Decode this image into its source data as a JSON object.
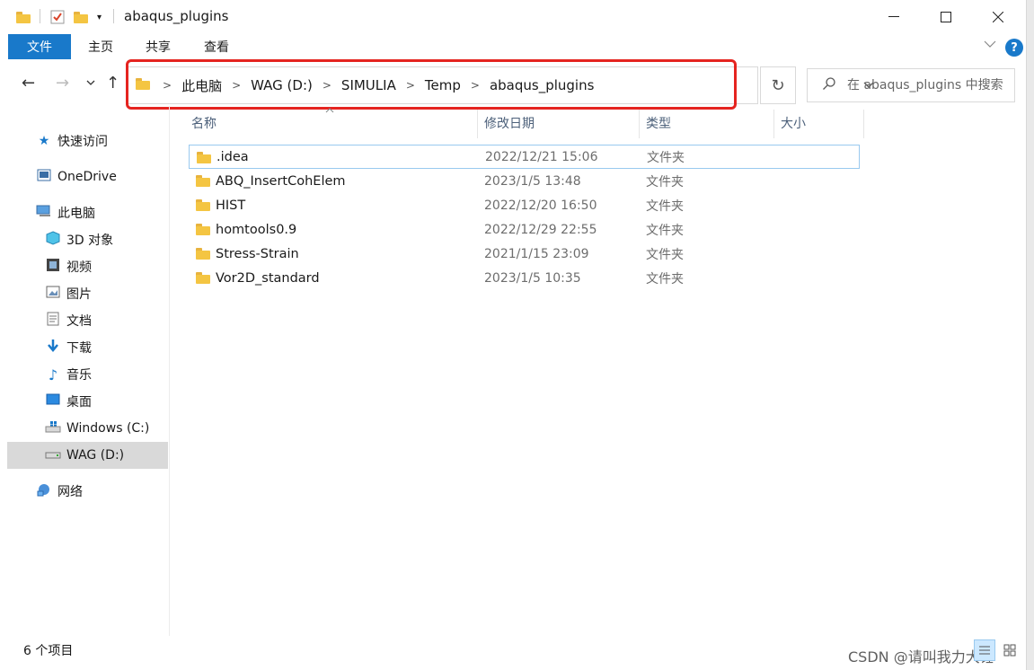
{
  "window": {
    "title": "abaqus_plugins"
  },
  "ribbon": {
    "tabs": [
      "文件",
      "主页",
      "共享",
      "查看"
    ],
    "help": "?"
  },
  "nav": {
    "back": "←",
    "forward": "→",
    "recent": "⌄",
    "up": "↑",
    "breadcrumbs": [
      "此电脑",
      "WAG (D:)",
      "SIMULIA",
      "Temp",
      "abaqus_plugins"
    ],
    "refresh": "↻",
    "search_placeholder": "在 abaqus_plugins 中搜索"
  },
  "sidebar": {
    "items": [
      {
        "label": "快速访问",
        "icon": "star-icon"
      },
      {
        "label": "OneDrive",
        "icon": "cloud-icon"
      },
      {
        "label": "此电脑",
        "icon": "computer-icon"
      },
      {
        "label": "3D 对象",
        "icon": "cube-icon"
      },
      {
        "label": "视频",
        "icon": "video-icon"
      },
      {
        "label": "图片",
        "icon": "image-icon"
      },
      {
        "label": "文档",
        "icon": "document-icon"
      },
      {
        "label": "下载",
        "icon": "download-icon"
      },
      {
        "label": "音乐",
        "icon": "music-icon"
      },
      {
        "label": "桌面",
        "icon": "desktop-icon"
      },
      {
        "label": "Windows (C:)",
        "icon": "windows-drive-icon"
      },
      {
        "label": "WAG (D:)",
        "icon": "drive-icon"
      },
      {
        "label": "网络",
        "icon": "network-icon"
      }
    ]
  },
  "table": {
    "columns": [
      "名称",
      "修改日期",
      "类型",
      "大小"
    ],
    "rows": [
      {
        "name": ".idea",
        "date": "2022/12/21 15:06",
        "type": "文件夹"
      },
      {
        "name": "ABQ_InsertCohElem",
        "date": "2023/1/5 13:48",
        "type": "文件夹"
      },
      {
        "name": "HIST",
        "date": "2022/12/20 16:50",
        "type": "文件夹"
      },
      {
        "name": "homtools0.9",
        "date": "2022/12/29 22:55",
        "type": "文件夹"
      },
      {
        "name": "Stress-Strain",
        "date": "2021/1/15 23:09",
        "type": "文件夹"
      },
      {
        "name": "Vor2D_standard",
        "date": "2023/1/5 10:35",
        "type": "文件夹"
      }
    ]
  },
  "status": {
    "count": "6 个项目",
    "watermark": "CSDN @请叫我力大锤"
  },
  "colors": {
    "accent": "#1979ca",
    "highlight": "#e52420",
    "folder": "#f4c542",
    "selection": "#d9d9d9"
  }
}
